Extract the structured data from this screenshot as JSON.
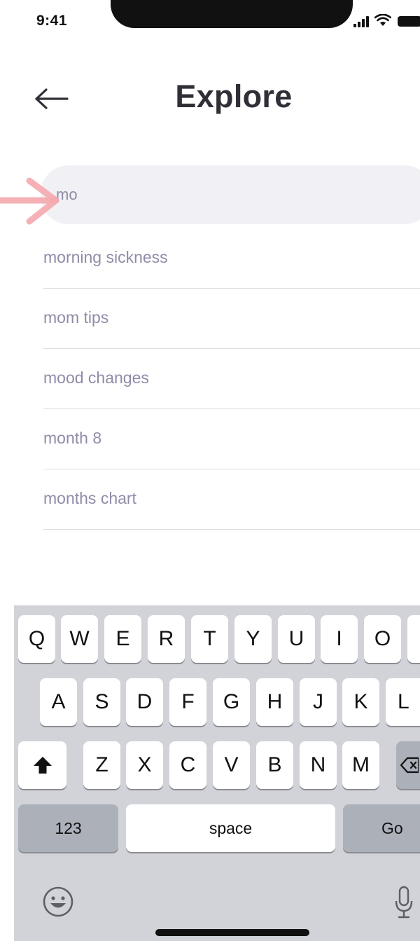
{
  "status_bar": {
    "time": "9:41"
  },
  "header": {
    "title": "Explore",
    "back_icon": "arrow-left-icon"
  },
  "search": {
    "value": "mo",
    "placeholder": ""
  },
  "suggestions": [
    "morning sickness",
    "mom tips",
    "mood changes",
    "month 8",
    "months chart"
  ],
  "keyboard": {
    "row1": [
      "Q",
      "W",
      "E",
      "R",
      "T",
      "Y",
      "U",
      "I",
      "O"
    ],
    "row2": [
      "A",
      "S",
      "D",
      "F",
      "G",
      "H",
      "J",
      "K",
      "L"
    ],
    "row3": [
      "Z",
      "X",
      "C",
      "V",
      "B",
      "N",
      "M"
    ],
    "numbers_label": "123",
    "space_label": "space",
    "go_label": "Go",
    "shift_icon": "shift-icon",
    "delete_icon": "backspace-icon",
    "emoji_icon": "emoji-icon",
    "mic_icon": "microphone-icon"
  },
  "colors": {
    "accent_pointer": "#f4a9ae",
    "suggestion_text": "#8f8ca8",
    "search_background": "#f1f1f5",
    "keyboard_background": "#d1d3d9"
  }
}
